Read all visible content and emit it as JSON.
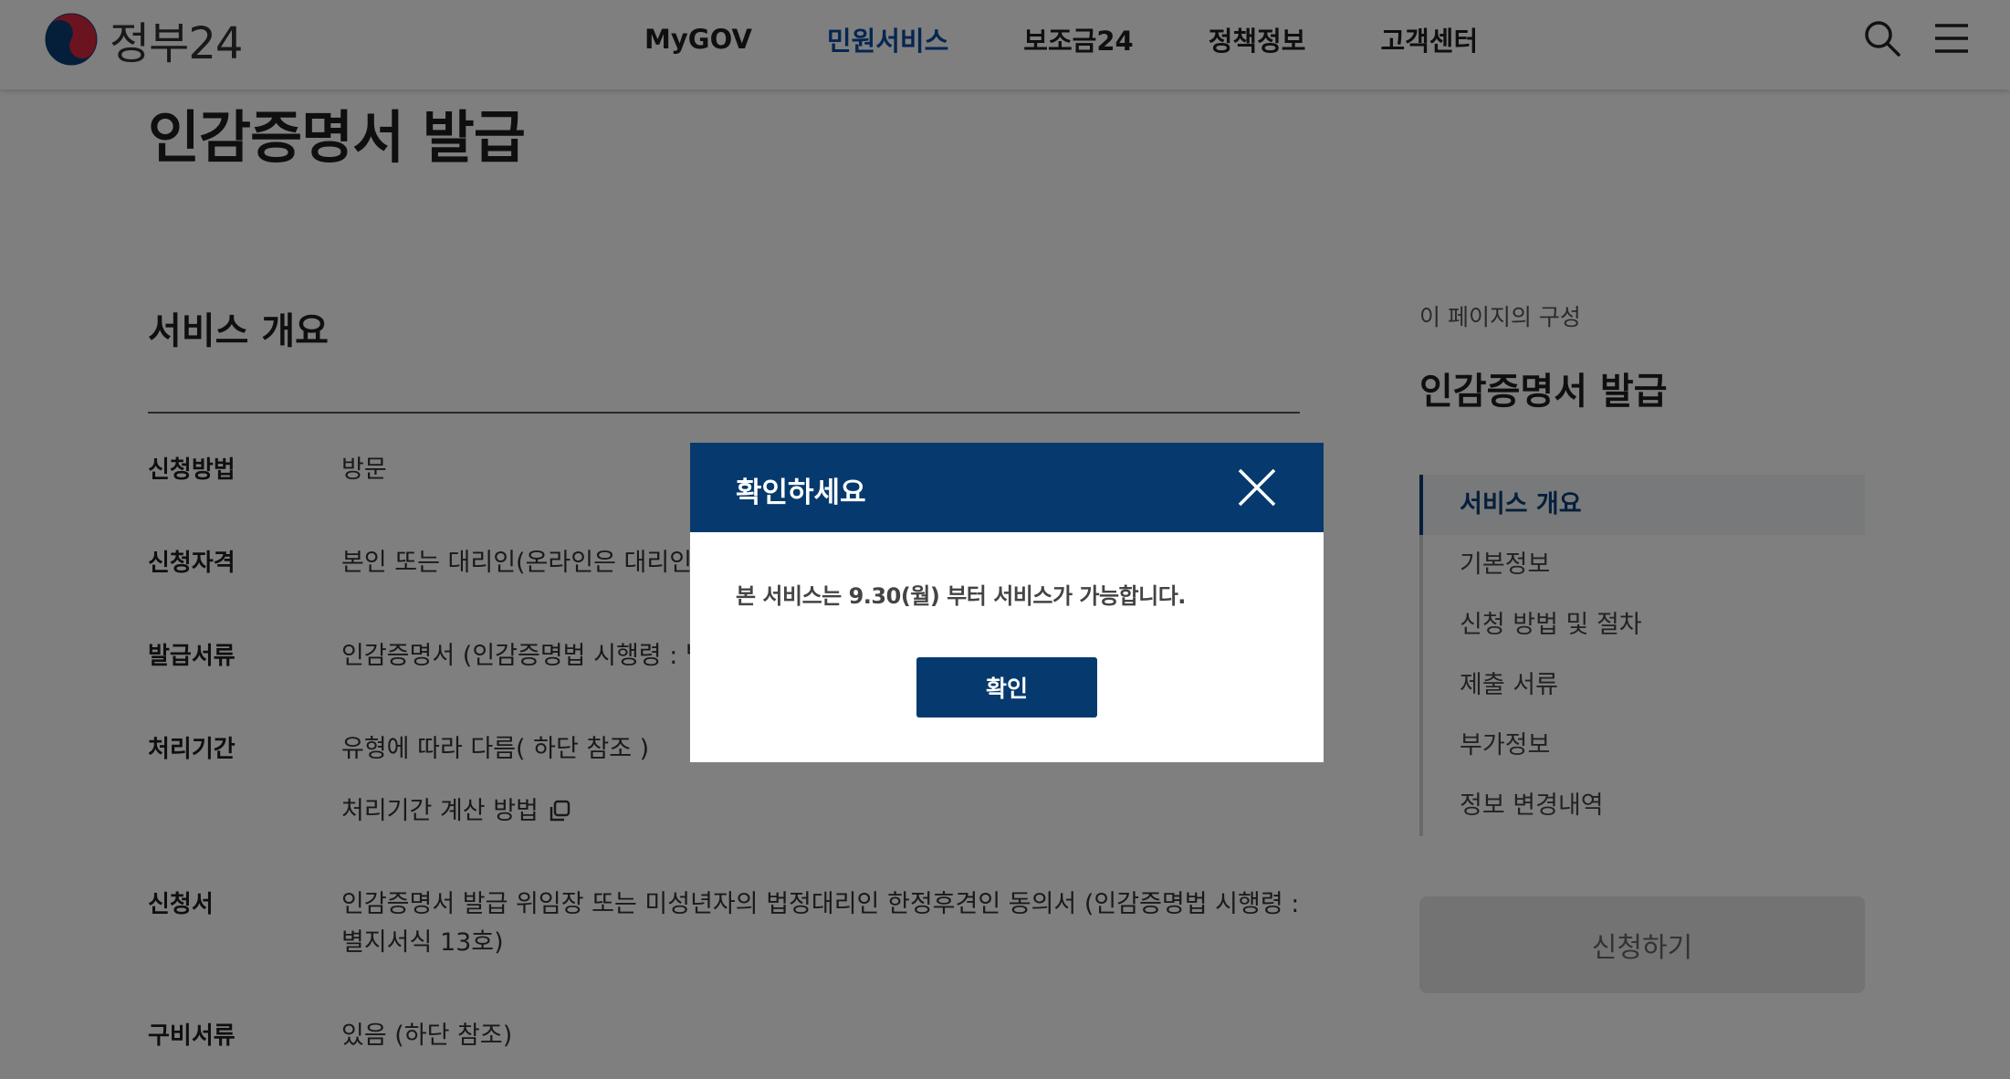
{
  "header": {
    "logo_text": "정부24",
    "nav": [
      {
        "label": "MyGOV"
      },
      {
        "label": "민원서비스",
        "active": true
      },
      {
        "label": "보조금24"
      },
      {
        "label": "정책정보"
      },
      {
        "label": "고객센터"
      }
    ],
    "icons": [
      "search-icon",
      "hamburger-menu-icon"
    ]
  },
  "page": {
    "title": "인감증명서 발급",
    "section_title": "서비스 개요",
    "rows": [
      {
        "label": "신청방법",
        "value": "방문"
      },
      {
        "label": "신청자격",
        "value": "본인 또는 대리인(온라인은 대리인 "
      },
      {
        "label": "발급서류",
        "value": "인감증명서 (인감증명법 시행령 : 별"
      },
      {
        "label": "처리기간",
        "value": "유형에 따라 다름( 하단 참조 )",
        "link": "처리기간 계산 방법"
      },
      {
        "label": "신청서",
        "value": "인감증명서 발급 위임장 또는 미성년자의 법정대리인 한정후견인 동의서 (인감증명법 시행령 : 별지서식 13호)"
      },
      {
        "label": "구비서류",
        "value": "있음 (하단 참조)"
      }
    ]
  },
  "toc": {
    "caption": "이 페이지의 구성",
    "title": "인감증명서 발급",
    "items": [
      {
        "label": "서비스 개요",
        "active": true
      },
      {
        "label": "기본정보"
      },
      {
        "label": "신청 방법 및 절차"
      },
      {
        "label": "제출 서류"
      },
      {
        "label": "부가정보"
      },
      {
        "label": "정보 변경내역"
      }
    ],
    "apply_label": "신청하기"
  },
  "modal": {
    "title": "확인하세요",
    "message": "본 서비스는 9.30(월) 부터 서비스가 가능합니다.",
    "confirm_label": "확인"
  },
  "colors": {
    "primary_navy": "#063a6e",
    "nav_active": "#0b4da2",
    "overlay": "rgba(0,0,0,0.5)"
  }
}
